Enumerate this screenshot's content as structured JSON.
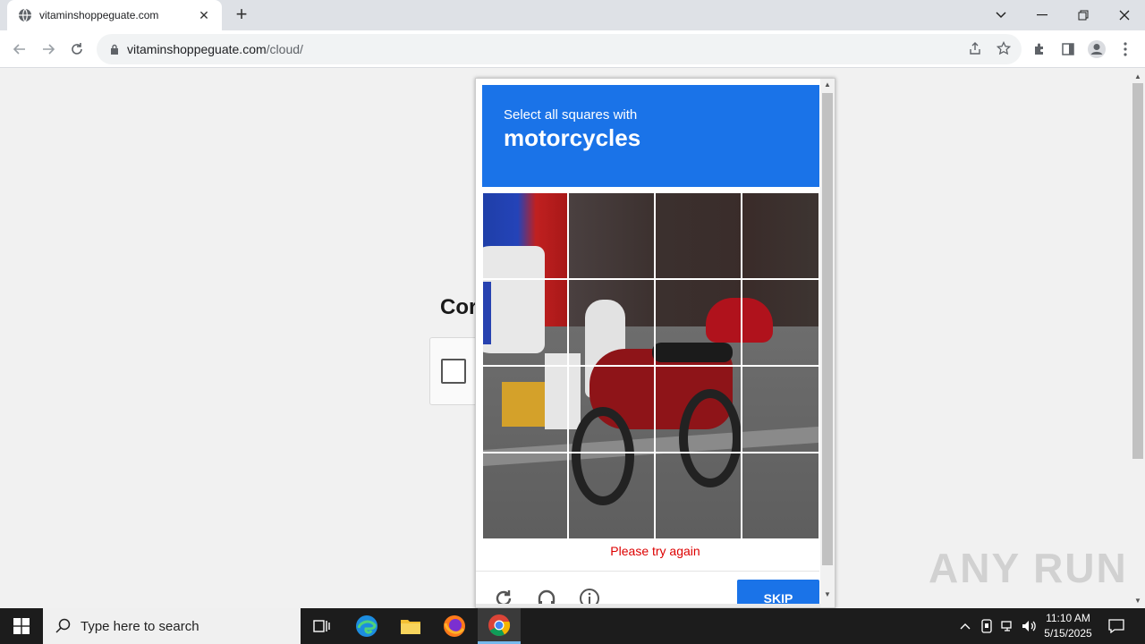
{
  "browser": {
    "tab_title": "vitaminshoppeguate.com",
    "url_host": "vitaminshoppeguate.com",
    "url_path": "/cloud/"
  },
  "page": {
    "heading_partial": "Cor"
  },
  "captcha": {
    "prompt_line1": "Select all squares with",
    "prompt_target": "motorcycles",
    "error": "Please try again",
    "skip_label": "SKIP",
    "grid_rows": 4,
    "grid_cols": 4
  },
  "watermark": "ANY RUN",
  "taskbar": {
    "search_placeholder": "Type here to search",
    "time": "11:10 AM",
    "date": "5/15/2025"
  },
  "colors": {
    "accent": "#1a73e8",
    "error": "#dd0000"
  }
}
